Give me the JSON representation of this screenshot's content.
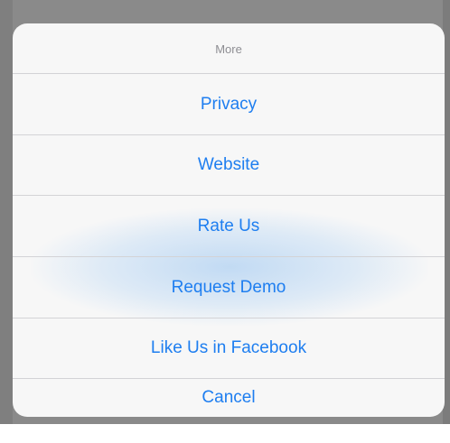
{
  "sheet": {
    "title": "More",
    "items": [
      {
        "label": "Privacy"
      },
      {
        "label": "Website"
      },
      {
        "label": "Rate Us"
      },
      {
        "label": "Request Demo"
      },
      {
        "label": "Like Us in Facebook"
      }
    ],
    "cancel_label": "Cancel"
  },
  "colors": {
    "action_text": "#1e7ef0",
    "header_text": "#8e8e93",
    "sheet_background": "#f7f7f7",
    "divider": "#d3d3d6",
    "backdrop": "#8a8a8a"
  }
}
